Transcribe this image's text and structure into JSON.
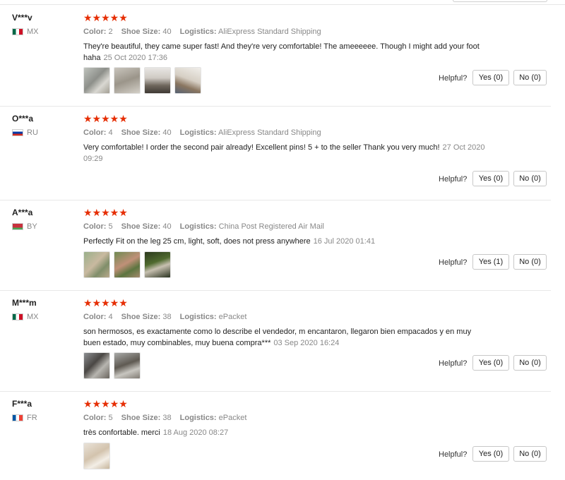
{
  "labels": {
    "color": "Color:",
    "shoe_size": "Shoe Size:",
    "logistics": "Logistics:",
    "helpful": "Helpful?"
  },
  "star_rating_text": "★★★★★",
  "colors": {
    "star": "#e62e04"
  },
  "reviews": [
    {
      "user": "V***v",
      "country": "MX",
      "rating": 5,
      "color": "2",
      "shoe_size": "40",
      "logistics": "AliExpress Standard Shipping",
      "text": "They're beautiful, they came super fast! And they're very comfortable! The ameeeeee. Though I might add your foot haha",
      "date": "25 Oct 2020 17:36",
      "yes": "Yes (0)",
      "no": "No (0)",
      "photos": 4
    },
    {
      "user": "O***a",
      "country": "RU",
      "rating": 5,
      "color": "4",
      "shoe_size": "40",
      "logistics": "AliExpress Standard Shipping",
      "text": "Very comfortable! I order the second pair already! Excellent pins! 5 + to the seller Thank you very much!",
      "date": "27 Oct 2020 09:29",
      "yes": "Yes (0)",
      "no": "No (0)",
      "photos": 0
    },
    {
      "user": "A***a",
      "country": "BY",
      "rating": 5,
      "color": "5",
      "shoe_size": "40",
      "logistics": "China Post Registered Air Mail",
      "text": "Perfectly Fit on the leg 25 cm, light, soft, does not press anywhere",
      "date": "16 Jul 2020 01:41",
      "yes": "Yes (1)",
      "no": "No (0)",
      "photos": 3
    },
    {
      "user": "M***m",
      "country": "MX",
      "rating": 5,
      "color": "4",
      "shoe_size": "38",
      "logistics": "ePacket",
      "text": "son hermosos, es exactamente como lo describe el vendedor, m encantaron, llegaron bien empacados y en muy buen estado, muy combinables, muy buena compra***",
      "date": "03 Sep 2020 16:24",
      "yes": "Yes (0)",
      "no": "No (0)",
      "photos": 2
    },
    {
      "user": "F***a",
      "country": "FR",
      "rating": 5,
      "color": "5",
      "shoe_size": "38",
      "logistics": "ePacket",
      "text": "très confortable. merci",
      "date": "18 Aug 2020 08:27",
      "yes": "Yes (0)",
      "no": "No (0)",
      "photos": 1
    }
  ]
}
